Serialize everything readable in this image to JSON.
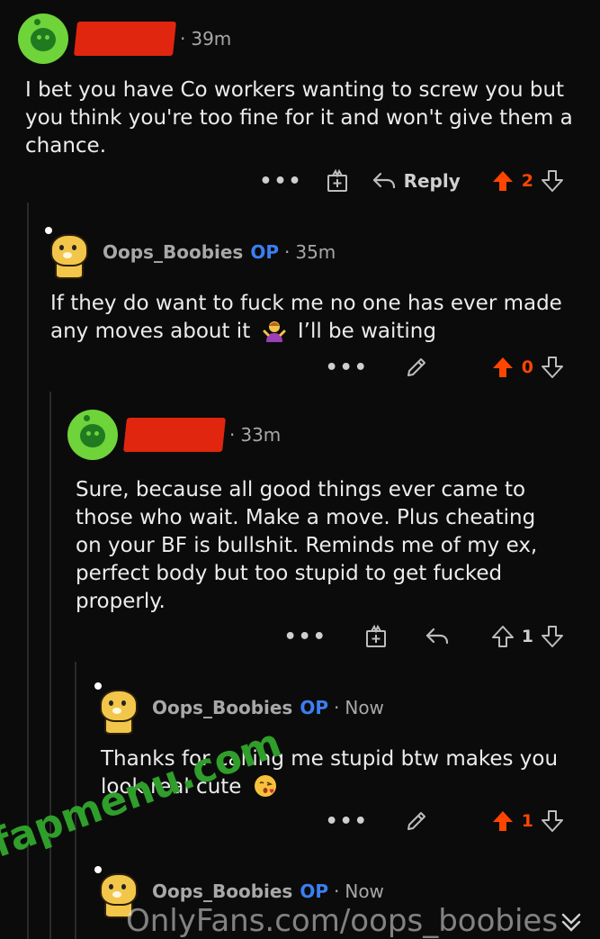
{
  "comments": [
    {
      "time": "39m",
      "text": "I bet you have Co workers wanting to screw you but you think you're too fine for it and won't give them a chance.",
      "reply_label": "Reply",
      "score": "2"
    },
    {
      "username": "Oops_Boobies",
      "op_badge": "OP",
      "time": "35m",
      "text_before": "If they do want to fuck me no one has ever made any moves about it",
      "text_after": "I’ll be waiting",
      "score": "0"
    },
    {
      "time": "33m",
      "text": "Sure, because all good things ever came to those who wait. Make a move. Plus cheating on your BF is bullshit. Reminds me of my ex, perfect body but too stupid to get fucked properly.",
      "score": "1"
    },
    {
      "username": "Oops_Boobies",
      "op_badge": "OP",
      "time": "Now",
      "text": "Thanks for calling me stupid btw makes you look real cute",
      "score": "1"
    },
    {
      "username": "Oops_Boobies",
      "op_badge": "OP",
      "time": "Now"
    }
  ],
  "watermarks": {
    "bottom": "OnlyFans.com/oops_boobies",
    "diagonal": "fapmenu.com"
  },
  "colors": {
    "background": "#0b0b0b",
    "upvote_active": "#ff4500",
    "op_badge": "#3a7ff2",
    "redaction": "#e0260f"
  },
  "icons": {
    "more": "more-options-icon",
    "award": "award-icon",
    "reply": "reply-arrow-icon",
    "edit": "pencil-icon",
    "upvote": "upvote-arrow-icon",
    "downvote": "downvote-arrow-icon"
  }
}
